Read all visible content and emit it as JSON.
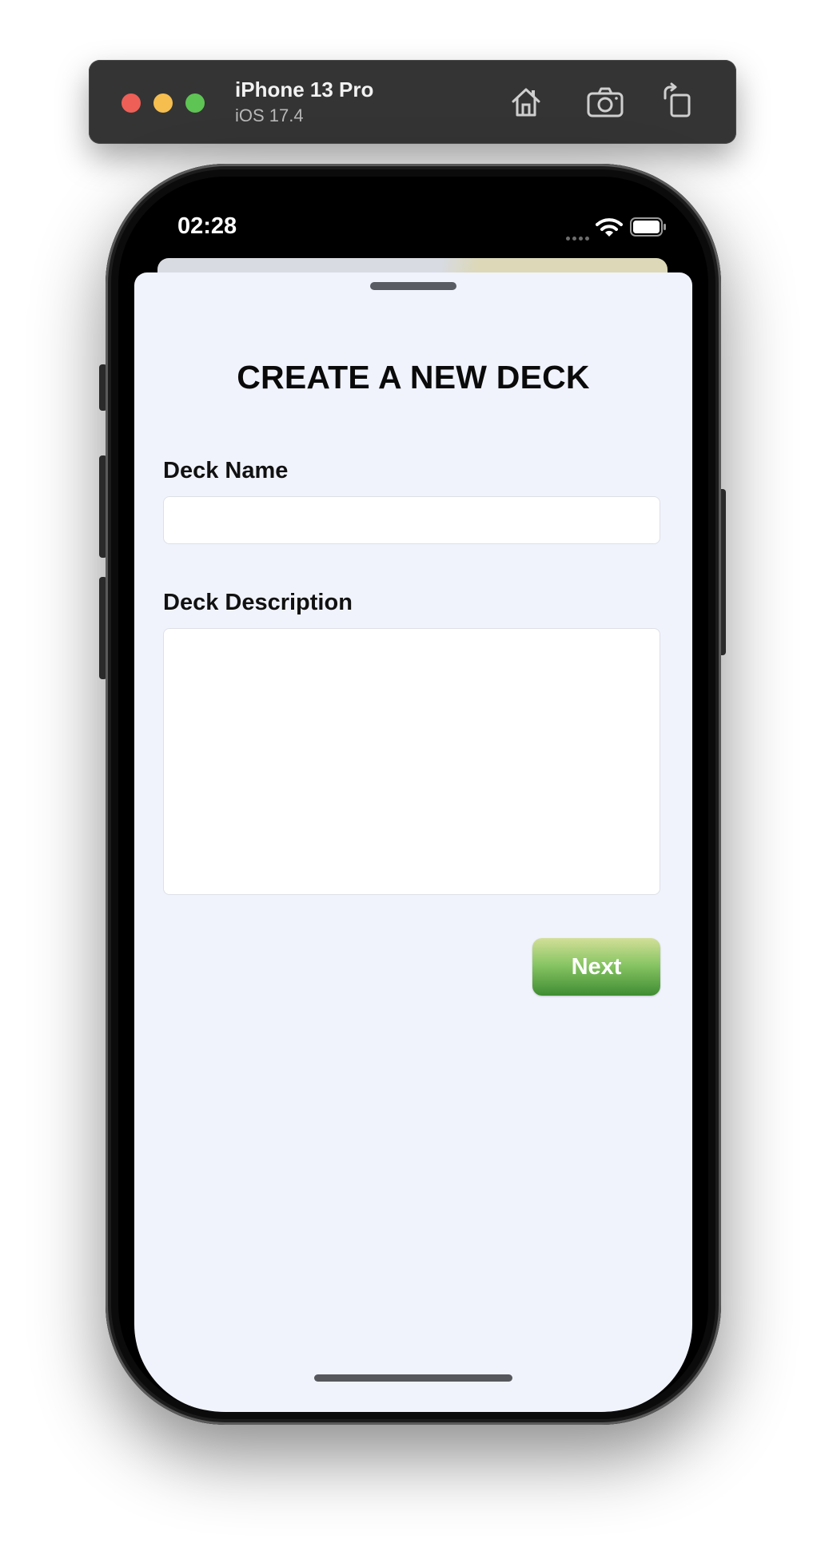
{
  "simulator": {
    "device_name": "iPhone 13 Pro",
    "os_version": "iOS 17.4",
    "icons": [
      "home-icon",
      "screenshot-camera-icon",
      "rotate-icon"
    ]
  },
  "status_bar": {
    "time": "02:28",
    "icons": [
      "wifi-icon",
      "battery-icon"
    ]
  },
  "sheet": {
    "title": "CREATE A NEW DECK",
    "deck_name": {
      "label": "Deck Name",
      "value": "",
      "placeholder": ""
    },
    "deck_description": {
      "label": "Deck Description",
      "value": "",
      "placeholder": ""
    },
    "next_label": "Next"
  },
  "colors": {
    "sheet_background": "#f0f3fc",
    "button_gradient_top": "#d2df98",
    "button_gradient_bottom": "#3f8d33",
    "toolbar_background": "#343434"
  }
}
